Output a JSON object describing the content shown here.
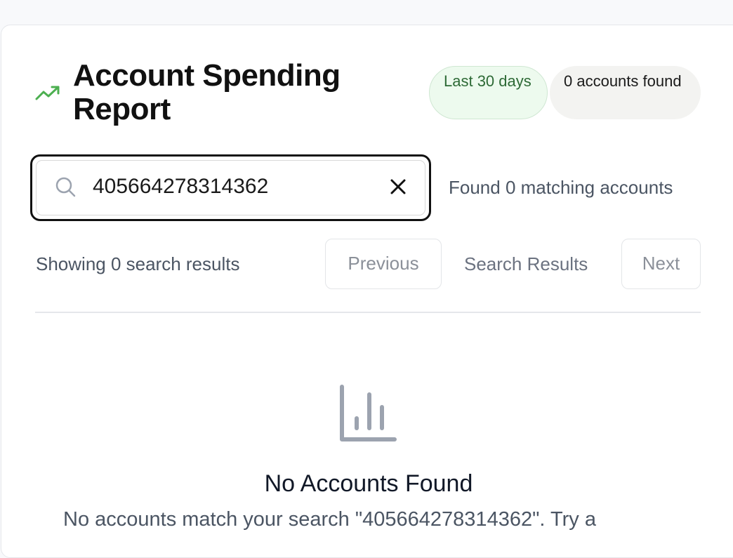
{
  "header": {
    "title": "Account Spending Report",
    "icon": "trending-up-icon",
    "accent_color": "#4caf50",
    "period_badge": "Last 30 days",
    "count_badge": "0 accounts found"
  },
  "search": {
    "value": "405664278314362",
    "icon": "search-icon",
    "clear_icon": "close-icon",
    "result_summary": "Found 0 matching accounts"
  },
  "pagination": {
    "showing_text": "Showing 0 search results",
    "previous_label": "Previous",
    "current_label": "Search Results",
    "next_label": "Next"
  },
  "empty_state": {
    "icon": "bar-chart-icon",
    "title": "No Accounts Found",
    "message": "No accounts match your search \"405664278314362\". Try a"
  }
}
